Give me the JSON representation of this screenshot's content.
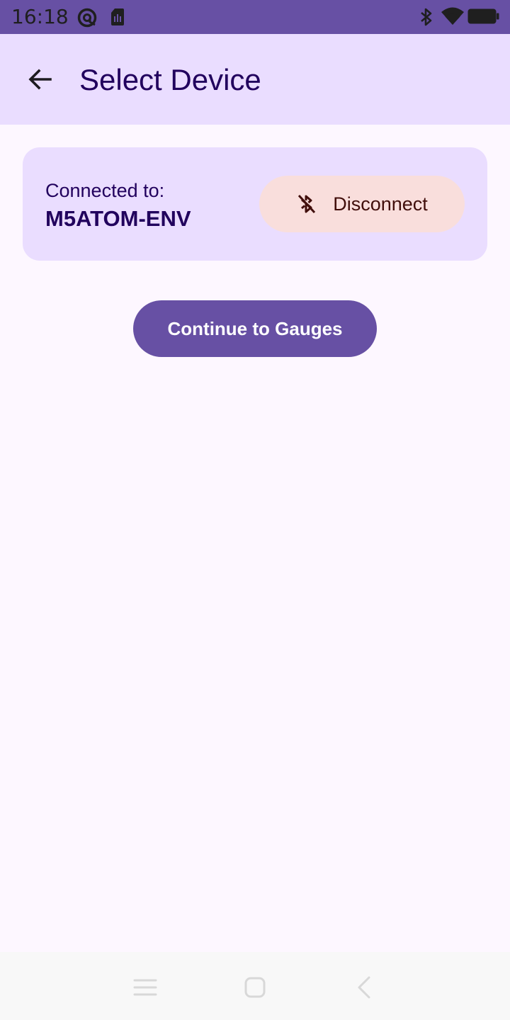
{
  "status_bar": {
    "time": "16:18",
    "icons": [
      "at-sync-icon",
      "sim-card-icon",
      "bluetooth-icon",
      "wifi-icon",
      "battery-icon"
    ],
    "background_color": "#6750a4"
  },
  "app_bar": {
    "back_icon": "arrow-back-icon",
    "title": "Select Device",
    "background_color": "#eaddff"
  },
  "device_card": {
    "connected_label": "Connected to:",
    "device_name": "M5ATOM-ENV",
    "disconnect_icon": "bluetooth-disabled-icon",
    "disconnect_label": "Disconnect",
    "card_color": "#eaddff",
    "disconnect_color": "#f9dedc"
  },
  "continue_button": {
    "label": "Continue to Gauges",
    "color": "#6750a4"
  },
  "nav_bar": {
    "icons": [
      "menu-icon",
      "home-icon",
      "back-icon"
    ]
  }
}
